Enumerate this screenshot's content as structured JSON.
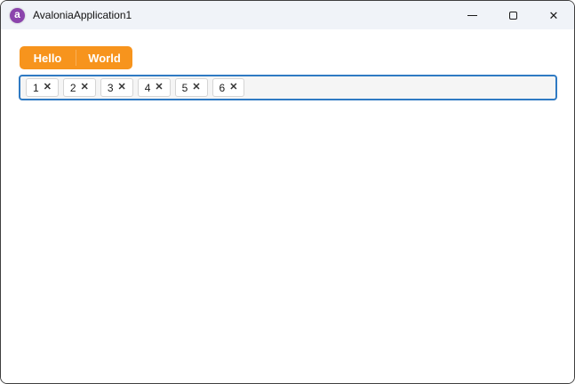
{
  "window": {
    "title": "AvaloniaApplication1"
  },
  "titlebar": {
    "logo_letter": "a",
    "close_glyph": "✕"
  },
  "split_button": {
    "hello_label": "Hello",
    "world_label": "World"
  },
  "tag_box": {
    "close_glyph": "✕",
    "items": [
      {
        "label": "1"
      },
      {
        "label": "2"
      },
      {
        "label": "3"
      },
      {
        "label": "4"
      },
      {
        "label": "5"
      },
      {
        "label": "6"
      }
    ]
  },
  "colors": {
    "accent_orange": "#F7941D",
    "focus_border_blue": "#2F7AC3",
    "logo_purple": "#8B44AC",
    "titlebar_bg": "#F0F3F8",
    "window_border": "#3F3F3F"
  },
  "icons": {
    "avalonia-logo-icon": "purple circle with white letter a",
    "minimize-icon": "horizontal line",
    "maximize-icon": "square outline",
    "close-icon": "✕"
  }
}
